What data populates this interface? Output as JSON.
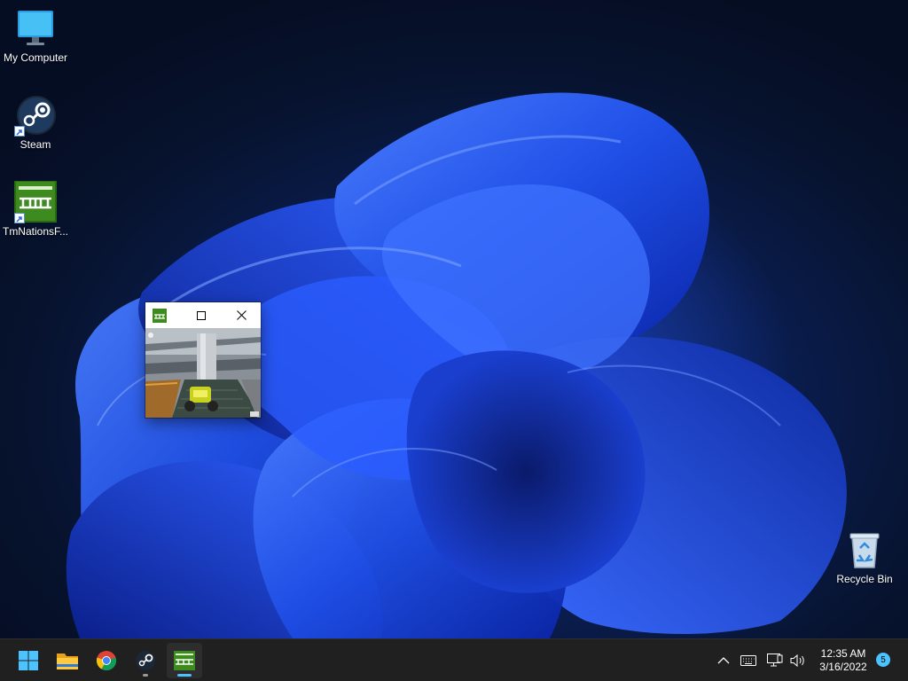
{
  "desktop": {
    "icons": [
      {
        "label": "My Computer",
        "icon": "monitor-icon"
      },
      {
        "label": "Steam",
        "icon": "steam-icon"
      },
      {
        "label": "TmNationsF...",
        "icon": "tmnations-icon"
      },
      {
        "label": "Recycle Bin",
        "icon": "recycle-bin-icon"
      }
    ]
  },
  "game_window": {
    "app_icon": "tmnations-icon",
    "controls": [
      "maximize-icon",
      "close-icon"
    ]
  },
  "taskbar": {
    "apps": [
      {
        "name": "Start",
        "icon": "windows-start-icon"
      },
      {
        "name": "File Explorer",
        "icon": "folder-icon"
      },
      {
        "name": "Google Chrome",
        "icon": "chrome-icon"
      },
      {
        "name": "Steam",
        "icon": "steam-icon",
        "state": "open"
      },
      {
        "name": "TmNationsForever",
        "icon": "tmnations-icon",
        "state": "focused"
      }
    ],
    "tray": {
      "icons": [
        "chevron-up-icon",
        "keyboard-icon",
        "network-icon",
        "volume-icon"
      ],
      "time": "12:35 AM",
      "date": "3/16/2022",
      "notification_count": "5"
    }
  },
  "colors": {
    "taskbar_bg": "#202020",
    "accent": "#4cc2ff",
    "wallpaper_dark": "#07132f",
    "wallpaper_bloom": "#1f4fe6"
  }
}
